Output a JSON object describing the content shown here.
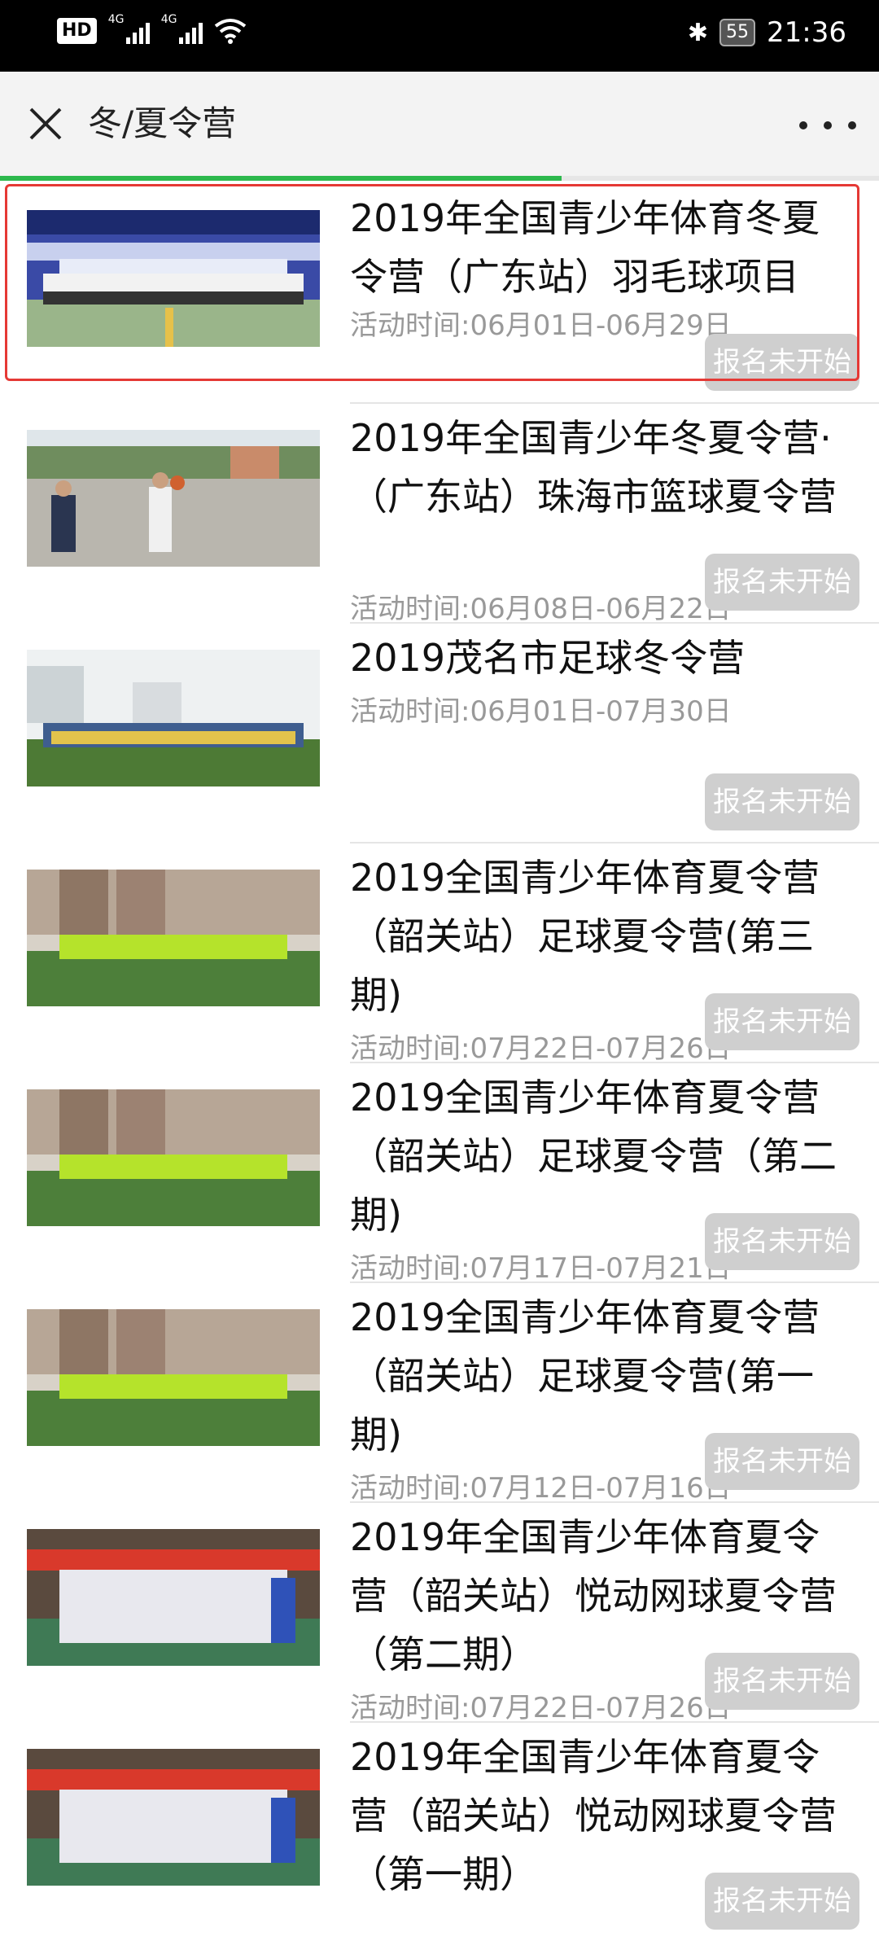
{
  "status_bar": {
    "hd": "HD",
    "net1": "4G",
    "net2": "4G",
    "battery": "55",
    "time": "21:36"
  },
  "header": {
    "title": "冬/夏令营"
  },
  "items": [
    {
      "title": "2019年全国青少年体育冬夏令营（广东站）羽毛球项目",
      "time": "活动时间:06月01日-06月29日",
      "status": "报名未开始"
    },
    {
      "title": "2019年全国青少年冬夏令营·（广东站）珠海市篮球夏令营",
      "time": "活动时间:06月08日-06月22日",
      "status": "报名未开始"
    },
    {
      "title": "2019茂名市足球冬令营",
      "time": "活动时间:06月01日-07月30日",
      "status": "报名未开始"
    },
    {
      "title": "2019全国青少年体育夏令营（韶关站）足球夏令营(第三期)",
      "time": "活动时间:07月22日-07月26日",
      "status": "报名未开始"
    },
    {
      "title": "2019全国青少年体育夏令营（韶关站）足球夏令营（第二期)",
      "time": "活动时间:07月17日-07月21日",
      "status": "报名未开始"
    },
    {
      "title": "2019全国青少年体育夏令营（韶关站）足球夏令营(第一期)",
      "time": "活动时间:07月12日-07月16日",
      "status": "报名未开始"
    },
    {
      "title": "2019年全国青少年体育夏令营（韶关站）悦动网球夏令营（第二期）",
      "time": "活动时间:07月22日-07月26日",
      "status": "报名未开始"
    },
    {
      "title": "2019年全国青少年体育夏令营（韶关站）悦动网球夏令营（第一期）",
      "time": "",
      "status": "报名未开始"
    }
  ]
}
